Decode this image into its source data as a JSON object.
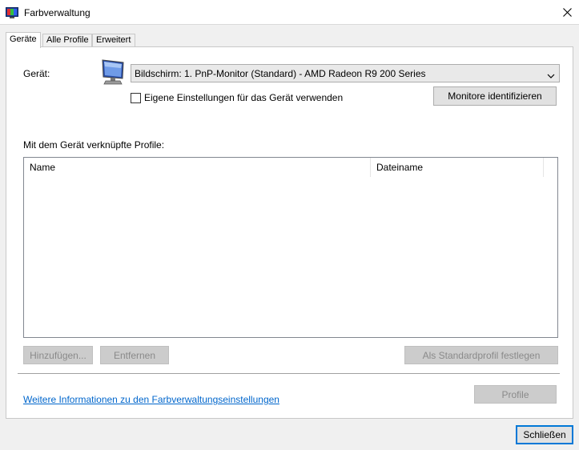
{
  "window": {
    "title": "Farbverwaltung",
    "app_icon": "color-management-icon",
    "close_icon": "close-icon"
  },
  "tabs": [
    {
      "label": "Geräte",
      "active": true
    },
    {
      "label": "Alle Profile",
      "active": false
    },
    {
      "label": "Erweitert",
      "active": false
    }
  ],
  "device": {
    "label": "Gerät:",
    "icon": "monitor-icon",
    "selected": "Bildschirm: 1. PnP-Monitor (Standard) - AMD Radeon R9 200 Series",
    "custom_settings_label": "Eigene Einstellungen für das Gerät verwenden",
    "custom_settings_checked": false,
    "identify_button": "Monitore identifizieren"
  },
  "profiles": {
    "label": "Mit dem Gerät verknüpfte Profile:",
    "columns": [
      "Name",
      "Dateiname"
    ],
    "rows": []
  },
  "actions": {
    "add": "Hinzufügen...",
    "remove": "Entfernen",
    "set_default": "Als Standardprofil festlegen",
    "profile": "Profile"
  },
  "info_link": "Weitere Informationen zu den Farbverwaltungseinstellungen",
  "close_button": "Schließen",
  "colors": {
    "accent": "#0078d7",
    "link": "#0066cc",
    "disabled_text": "#8a8a8a"
  }
}
